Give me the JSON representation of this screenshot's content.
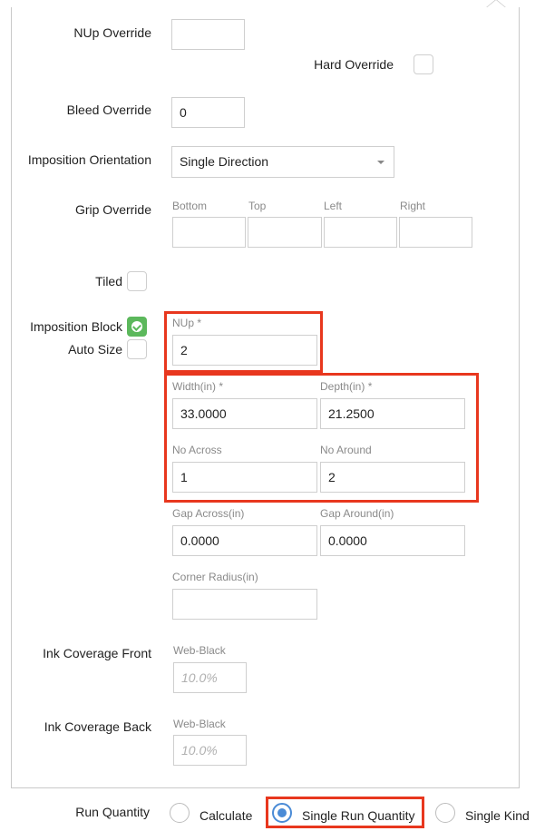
{
  "form": {
    "nup_override": {
      "label": "NUp Override",
      "value": ""
    },
    "hard_override": {
      "label": "Hard Override",
      "checked": false
    },
    "bleed_override": {
      "label": "Bleed Override",
      "value": "0"
    },
    "imposition_orientation": {
      "label": "Imposition Orientation",
      "value": "Single Direction"
    },
    "grip_override": {
      "label": "Grip Override",
      "fields": [
        {
          "label": "Bottom",
          "value": ""
        },
        {
          "label": "Top",
          "value": ""
        },
        {
          "label": "Left",
          "value": ""
        },
        {
          "label": "Right",
          "value": ""
        }
      ]
    },
    "tiled": {
      "label": "Tiled",
      "checked": false
    },
    "imposition_block": {
      "label": "Imposition Block",
      "checked": true
    },
    "auto_size": {
      "label": "Auto Size",
      "checked": false
    },
    "nup": {
      "label": "NUp *",
      "value": "2"
    },
    "width": {
      "label": "Width(in) *",
      "value": "33.0000"
    },
    "depth": {
      "label": "Depth(in) *",
      "value": "21.2500"
    },
    "no_across": {
      "label": "No Across",
      "value": "1"
    },
    "no_around": {
      "label": "No Around",
      "value": "2"
    },
    "gap_across": {
      "label": "Gap Across(in)",
      "value": "0.0000"
    },
    "gap_around": {
      "label": "Gap Around(in)",
      "value": "0.0000"
    },
    "corner_radius": {
      "label": "Corner Radius(in)",
      "value": ""
    },
    "ink_front": {
      "label": "Ink Coverage Front",
      "sub": "Web-Black",
      "placeholder": "10.0%"
    },
    "ink_back": {
      "label": "Ink Coverage Back",
      "sub": "Web-Black",
      "placeholder": "10.0%"
    }
  },
  "run_quantity": {
    "label": "Run Quantity",
    "options": [
      {
        "label": "Calculate",
        "selected": false
      },
      {
        "label": "Single Run Quantity",
        "selected": true
      },
      {
        "label": "Single Kind",
        "selected": false
      }
    ]
  },
  "colors": {
    "highlight": "#e8371e",
    "checked_green": "#5cb85c",
    "radio_blue": "#4a8bd6"
  }
}
